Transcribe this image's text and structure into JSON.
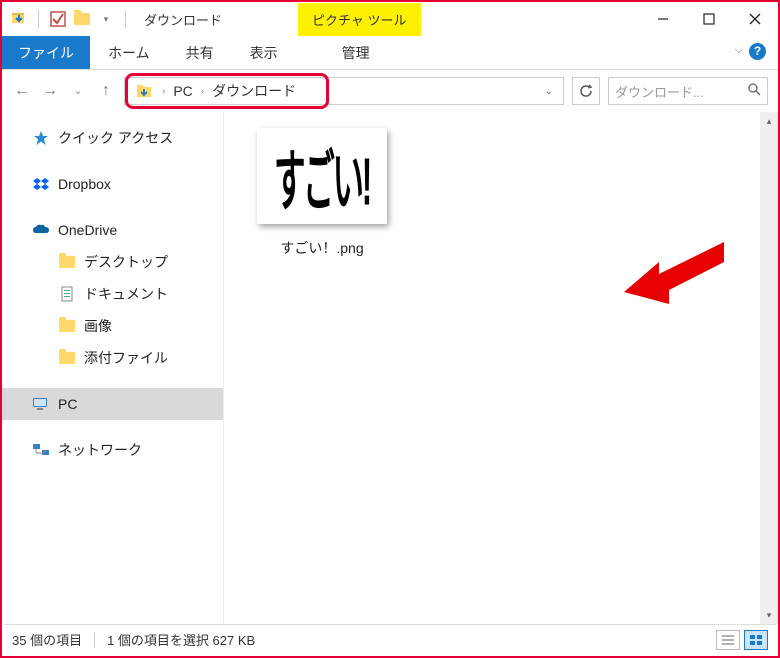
{
  "titlebar": {
    "title": "ダウンロード",
    "context_tab": "ピクチャ ツール"
  },
  "ribbon": {
    "file": "ファイル",
    "home": "ホーム",
    "share": "共有",
    "view": "表示",
    "context": "管理"
  },
  "breadcrumb": {
    "root": "PC",
    "current": "ダウンロード"
  },
  "search": {
    "placeholder": "ダウンロード..."
  },
  "nav": {
    "quick_access": "クイック アクセス",
    "dropbox": "Dropbox",
    "onedrive": "OneDrive",
    "onedrive_children": {
      "desktop": "デスクトップ",
      "documents": "ドキュメント",
      "pictures": "画像",
      "attachments": "添付ファイル"
    },
    "pc": "PC",
    "network": "ネットワーク"
  },
  "file": {
    "thumb_text": "すごい!",
    "name": "すごい！.png"
  },
  "status": {
    "count": "35 個の項目",
    "selection": "1 個の項目を選択 627 KB"
  }
}
